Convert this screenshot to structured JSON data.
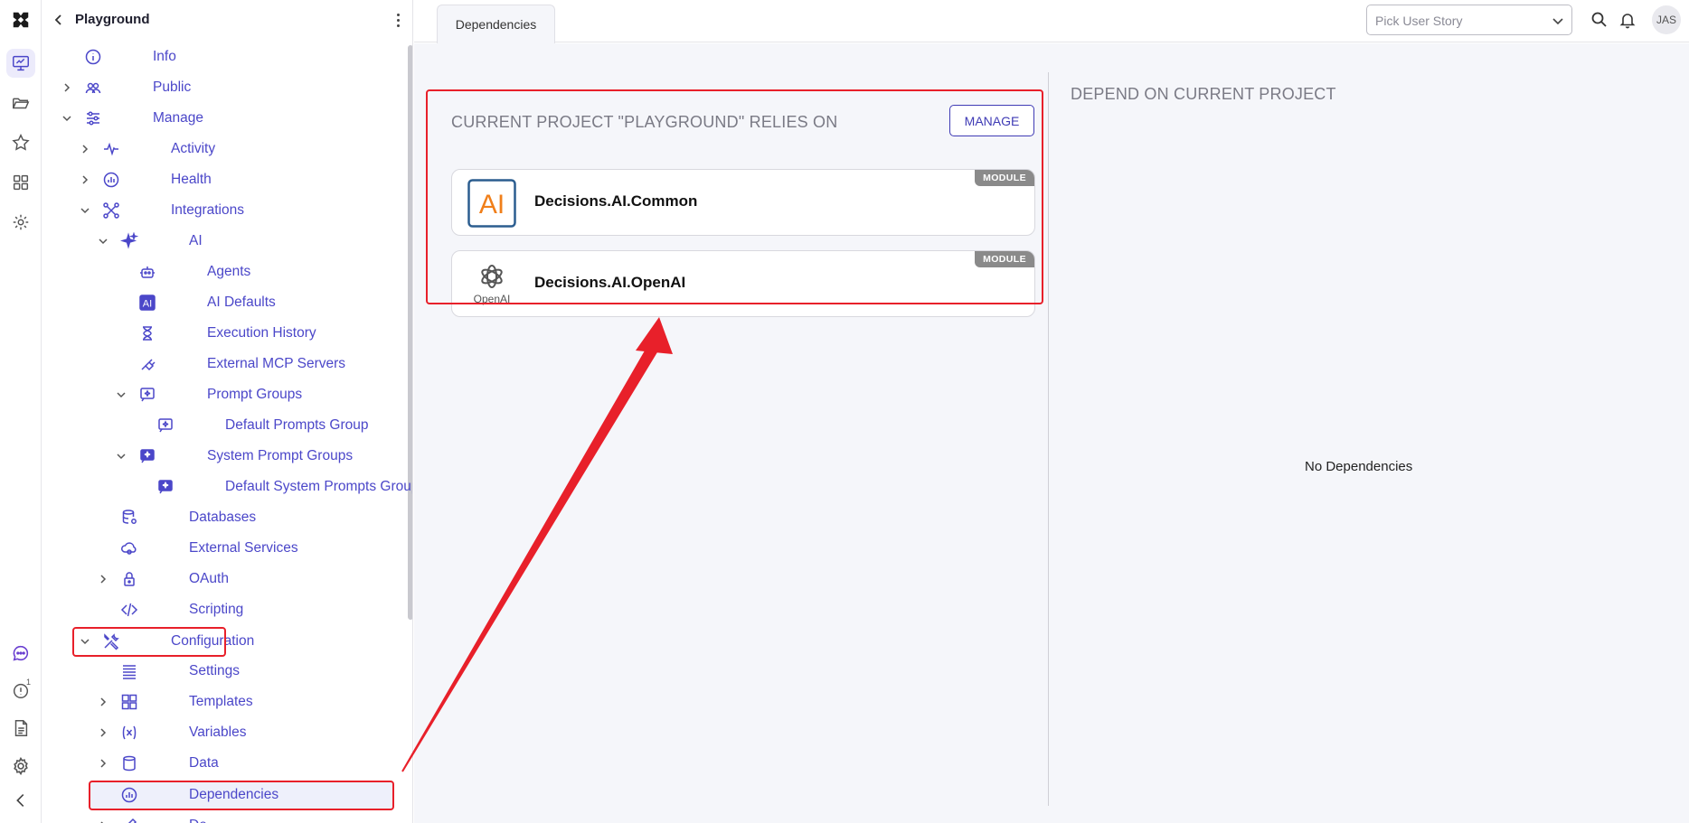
{
  "app": {
    "project_name": "Playground",
    "colors": {
      "accent": "#4b47c9",
      "highlight": "#e8202a",
      "badge": "#8a8a8a"
    }
  },
  "rail": {
    "items": [
      {
        "icon": "logo-icon"
      },
      {
        "icon": "project-dashboard-icon",
        "active": true
      },
      {
        "icon": "folder-open-icon"
      },
      {
        "icon": "star-icon"
      },
      {
        "icon": "grid-apps-icon"
      },
      {
        "icon": "gear-icon"
      },
      {
        "icon": "chat-icon"
      },
      {
        "icon": "alert-info-icon",
        "badge": "1"
      },
      {
        "icon": "document-icon"
      },
      {
        "icon": "settings-cog-icon"
      },
      {
        "icon": "collapse-chevron-icon"
      }
    ]
  },
  "tree": {
    "items": [
      {
        "label": "Info",
        "icon": "info-icon"
      },
      {
        "label": "Public",
        "icon": "people-icon",
        "chevron": "collapsed"
      },
      {
        "label": "Manage",
        "icon": "sliders-icon",
        "chevron": "expanded"
      },
      {
        "label": "Activity",
        "icon": "activity-icon",
        "chevron": "collapsed"
      },
      {
        "label": "Health",
        "icon": "health-gauge-icon",
        "chevron": "collapsed"
      },
      {
        "label": "Integrations",
        "icon": "integrations-icon",
        "chevron": "expanded"
      },
      {
        "label": "AI",
        "icon": "sparkle-icon",
        "chevron": "expanded"
      },
      {
        "label": "Agents",
        "icon": "robot-icon"
      },
      {
        "label": "AI Defaults",
        "icon": "ai-badge-icon"
      },
      {
        "label": "Execution History",
        "icon": "hourglass-icon"
      },
      {
        "label": "External MCP Servers",
        "icon": "plug-icon"
      },
      {
        "label": "Prompt Groups",
        "icon": "prompt-group-icon",
        "chevron": "expanded"
      },
      {
        "label": "Default Prompts Group",
        "icon": "prompt-group-icon"
      },
      {
        "label": "System Prompt Groups",
        "icon": "system-prompt-icon",
        "chevron": "expanded"
      },
      {
        "label": "Default System Prompts Group",
        "icon": "system-prompt-icon"
      },
      {
        "label": "Databases",
        "icon": "database-gear-icon"
      },
      {
        "label": "External Services",
        "icon": "cloud-gear-icon"
      },
      {
        "label": "OAuth",
        "icon": "lock-icon",
        "chevron": "collapsed"
      },
      {
        "label": "Scripting",
        "icon": "code-icon"
      },
      {
        "label": "Configuration",
        "icon": "tools-icon",
        "chevron": "expanded",
        "highlighted": true
      },
      {
        "label": "Settings",
        "icon": "list-lines-icon"
      },
      {
        "label": "Templates",
        "icon": "templates-icon",
        "chevron": "collapsed"
      },
      {
        "label": "Variables",
        "icon": "variable-icon",
        "chevron": "collapsed"
      },
      {
        "label": "Data",
        "icon": "cylinder-icon",
        "chevron": "collapsed"
      },
      {
        "label": "Dependencies",
        "icon": "dependencies-icon",
        "selected": true,
        "highlighted": true
      },
      {
        "label": "De...",
        "icon": "design-icon",
        "chevron": "collapsed"
      }
    ]
  },
  "topbar": {
    "tab_label": "Dependencies",
    "story_placeholder": "Pick User Story",
    "avatar_initials": "JAS"
  },
  "main": {
    "relies_on_title": "CURRENT PROJECT \"PLAYGROUND\" RELIES ON",
    "manage_label": "MANAGE",
    "dependencies": [
      {
        "name": "Decisions.AI.Common",
        "badge": "MODULE",
        "logo": "ai-logo-icon"
      },
      {
        "name": "Decisions.AI.OpenAI",
        "badge": "MODULE",
        "logo": "openai-logo-icon",
        "logo_text": "OpenAI"
      }
    ],
    "depend_on_title": "DEPEND ON CURRENT PROJECT",
    "empty_text": "No Dependencies"
  }
}
